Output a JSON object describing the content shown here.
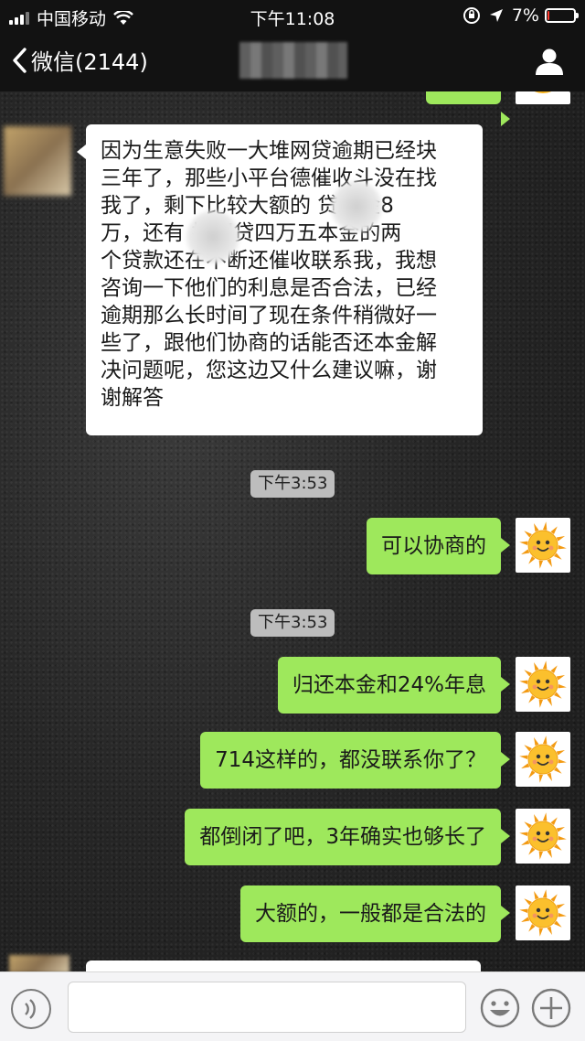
{
  "status_bar": {
    "carrier": "中国移动",
    "time": "下午11:08",
    "battery_percent": "7%",
    "battery_level": 0.07
  },
  "nav": {
    "back_label": "微信(2144)"
  },
  "messages": {
    "incoming_1": "因为生意失败一大堆网贷逾期已经块三年了，那些小平台德催收斗没在找我了，剩下比较大额的 贷本金8万，还有 拉网贷四万五本金的两个贷款还在不断还催收联系我，我想咨询一下他们的利息是否合法，已经逾期那么长时间了现在条件稍微好一些了，跟他们协商的话能否还本金解决问题呢，您这边又什么建议嘛，谢谢解答",
    "incoming_lines": [
      "因为生意失败一大堆网贷逾期已经块",
      "三年了，那些小平台德催收斗没在找",
      "我了，剩下比较大额的 贷本金8",
      "万，还有 拉网贷四万五本金的两",
      "个贷款还在不断还催收联系我，我想",
      "咨询一下他们的利息是否合法，已经",
      "逾期那么长时间了现在条件稍微好一",
      "些了，跟他们协商的话能否还本金解",
      "决问题呢，您这边又什么建议嘛，谢",
      "谢解答"
    ],
    "timestamp_1": "下午3:53",
    "out_1": "可以协商的",
    "timestamp_2": "下午3:53",
    "out_2": "归还本金和24%年息",
    "out_3": "714这样的，都没联系你了？",
    "out_4": "都倒闭了吧，3年确实也够长了",
    "out_5": "大额的，一般都是合法的"
  },
  "icons": {
    "back": "chevron-left-icon",
    "profile": "person-icon",
    "voice": "voice-icon",
    "emoji": "emoji-icon",
    "plus": "plus-icon"
  },
  "colors": {
    "outgoing_bubble": "#9ee85c",
    "incoming_bubble": "#ffffff",
    "bar": "#121212"
  }
}
